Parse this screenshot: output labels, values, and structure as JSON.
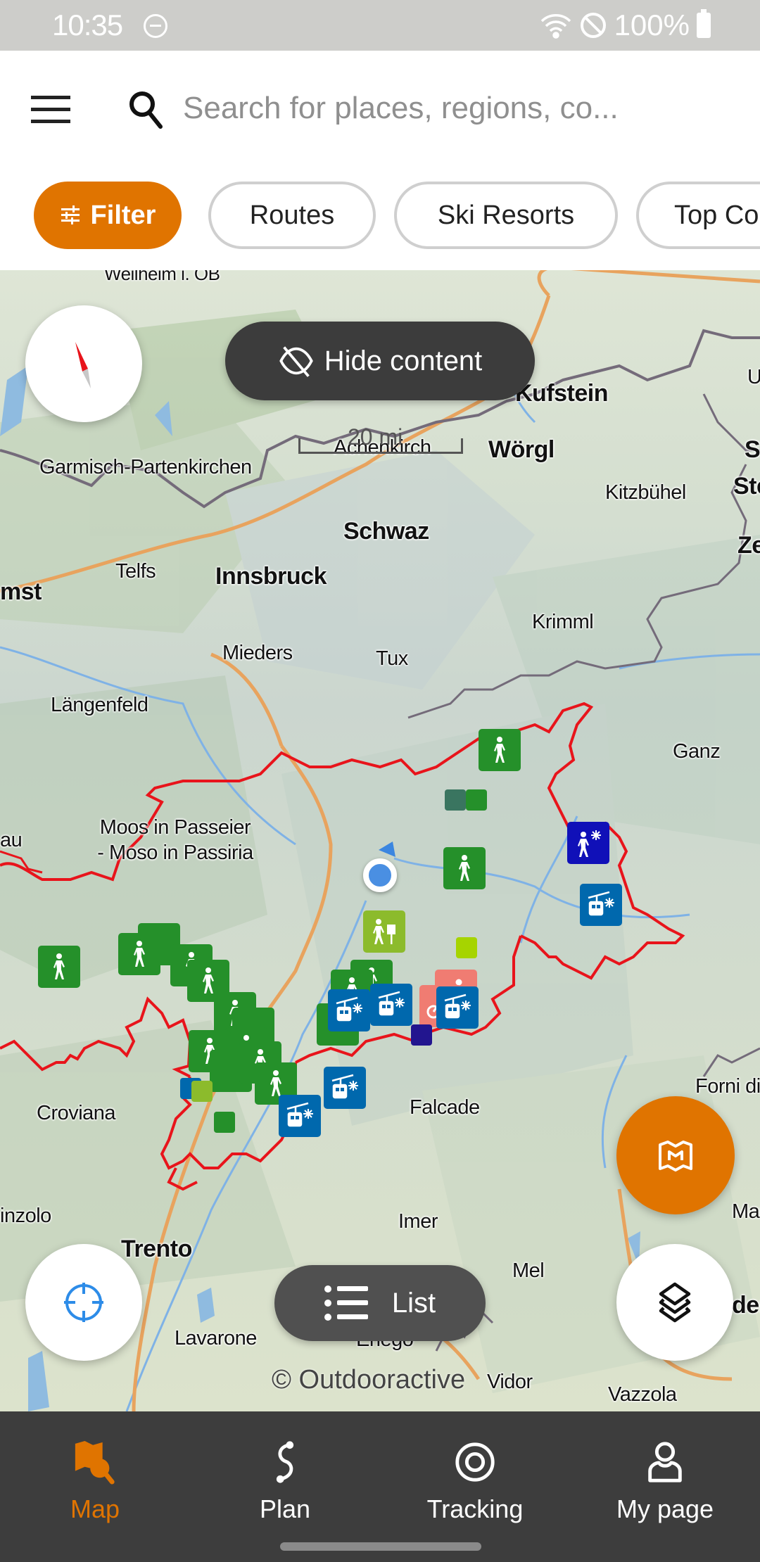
{
  "status_bar": {
    "time": "10:35",
    "battery": "100%",
    "icons": [
      "do-not-disturb-icon",
      "wifi-icon",
      "blocked-icon",
      "battery-icon"
    ]
  },
  "header": {
    "menu_icon": "hamburger-menu-icon",
    "search_placeholder": "Search for places, regions, co..."
  },
  "chips": [
    {
      "label": "Filter",
      "active": true,
      "icon": "sliders-icon"
    },
    {
      "label": "Routes",
      "active": false
    },
    {
      "label": "Ski Resorts",
      "active": false
    },
    {
      "label": "Top Co",
      "active": false
    }
  ],
  "map": {
    "hide_content_label": "Hide content",
    "scale_label": "20 mi",
    "copyright": "© Outdooractive",
    "list_label": "List",
    "places": [
      {
        "name": "Weilheim i. OB",
        "major": false
      },
      {
        "name": "Kufstein",
        "major": true
      },
      {
        "name": "Wörgl",
        "major": true
      },
      {
        "name": "Achenkirch",
        "major": false
      },
      {
        "name": "Garmisch-Partenkirchen",
        "major": false
      },
      {
        "name": "Kitzbühel",
        "major": false
      },
      {
        "name": "Schwaz",
        "major": true
      },
      {
        "name": "Telfs",
        "major": false
      },
      {
        "name": "Innsbruck",
        "major": true
      },
      {
        "name": "mst",
        "major": true
      },
      {
        "name": "Krimml",
        "major": false
      },
      {
        "name": "Mieders",
        "major": false
      },
      {
        "name": "Tux",
        "major": false
      },
      {
        "name": "Längenfeld",
        "major": false
      },
      {
        "name": "Ganz",
        "major": false
      },
      {
        "name": "Moos in Passeier - Moso in Passiria",
        "major": false
      },
      {
        "name": "au",
        "major": false
      },
      {
        "name": "Croviana",
        "major": false
      },
      {
        "name": "Falcade",
        "major": false
      },
      {
        "name": "Forni di",
        "major": false
      },
      {
        "name": "inzolo",
        "major": false
      },
      {
        "name": "Imer",
        "major": false
      },
      {
        "name": "Mar",
        "major": false
      },
      {
        "name": "Trento",
        "major": true
      },
      {
        "name": "Mel",
        "major": false
      },
      {
        "name": "Lavarone",
        "major": false
      },
      {
        "name": "Enego",
        "major": false
      },
      {
        "name": "Vidor",
        "major": false
      },
      {
        "name": "Vazzola",
        "major": false
      },
      {
        "name": "U",
        "major": false
      },
      {
        "name": "Sa",
        "major": true
      },
      {
        "name": "Ste",
        "major": true
      },
      {
        "name": "Ze",
        "major": true
      },
      {
        "name": "der",
        "major": true
      }
    ],
    "poi_colors": {
      "hiking": "#25902a",
      "ski_lift": "#0068ad",
      "winter_hiking": "#1010b8",
      "theme_trail": "#8cbb2c",
      "bike": "#f07c72",
      "lime": "#a6d400",
      "teal": "#3a7560",
      "navy": "#22158f"
    }
  },
  "controls": {
    "compass_icon": "compass-icon",
    "locate_icon": "crosshair-locate-icon",
    "layers_icon": "layers-icon",
    "mapbook_icon": "map-book-icon"
  },
  "bottom_nav": [
    {
      "label": "Map",
      "icon": "map-search-icon",
      "active": true
    },
    {
      "label": "Plan",
      "icon": "route-plan-icon",
      "active": false
    },
    {
      "label": "Tracking",
      "icon": "tracking-target-icon",
      "active": false
    },
    {
      "label": "My page",
      "icon": "user-icon",
      "active": false
    }
  ],
  "colors": {
    "accent": "#e07400",
    "nav_bg": "#3d3d3d",
    "border_red": "#e8141b",
    "location_blue": "#4a8fe2"
  }
}
